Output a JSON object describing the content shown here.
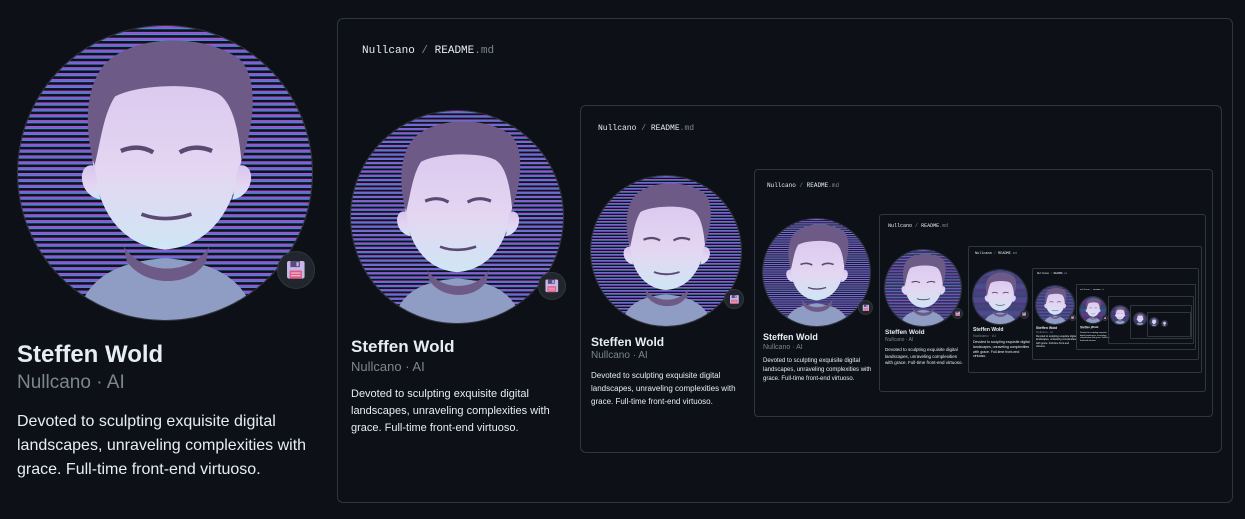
{
  "profile": {
    "name": "Steffen Wold",
    "handle": "Nullcano · AI",
    "bio": "Devoted to sculpting exquisite digital landscapes, unraveling complexities with grace. Full-time front-end virtuoso.",
    "status_icon": "floppy-disk-icon"
  },
  "readme": {
    "owner": "Nullcano",
    "separator": "/",
    "file": "README",
    "ext": ".md"
  },
  "colors": {
    "background": "#0d1117",
    "border": "#30363d",
    "muted": "#7d8590",
    "avatar_stripe_top": "#b04fd8",
    "avatar_stripe_bottom": "#2aa3d6",
    "face": "#e4d6f2",
    "hair": "#6d5a86"
  }
}
